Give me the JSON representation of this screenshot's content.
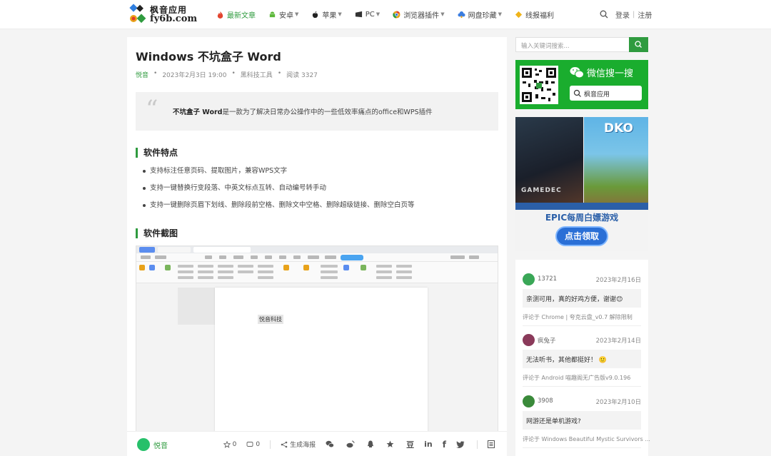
{
  "header": {
    "logo_line1": "枫音应用",
    "logo_line2": "fy6b.com",
    "nav": [
      {
        "label": "最新文章",
        "icon": "fire-icon",
        "active": true,
        "dropdown": false
      },
      {
        "label": "安卓",
        "icon": "android-icon",
        "active": false,
        "dropdown": true
      },
      {
        "label": "苹果",
        "icon": "apple-icon",
        "active": false,
        "dropdown": true
      },
      {
        "label": "PC",
        "icon": "pc-icon",
        "active": false,
        "dropdown": true
      },
      {
        "label": "浏览器插件",
        "icon": "chrome-icon",
        "active": false,
        "dropdown": true
      },
      {
        "label": "网盘珍藏",
        "icon": "cloud-icon",
        "active": false,
        "dropdown": true
      },
      {
        "label": "线报福利",
        "icon": "gift-icon",
        "active": false,
        "dropdown": false
      }
    ],
    "login": "登录",
    "register": "注册"
  },
  "article": {
    "title": "Windows 不坑盒子 Word",
    "author": "悦音",
    "date": "2023年2月3日 19:00",
    "category": "黑科技工具",
    "views": "阅读 3327",
    "quote_bold": "不坑盒子 Word",
    "quote_rest": "是一款为了解决日常办公操作中的一些低效率痛点的office和WPS插件",
    "section1": "软件特点",
    "features": [
      "支持标注任意页码、提取图片，兼容WPS文字",
      "支持一键替换行变段落、中英文标点互转、自动编号转手动",
      "支持一键删除页眉下划线、删除段前空格、删除文中空格、删除超级链接、删除空白页等"
    ],
    "section2": "软件截图",
    "screenshot_text": "悦音科技"
  },
  "toolbar": {
    "author": "悦音",
    "likes": "0",
    "comments": "0",
    "poster": "生成海报"
  },
  "sidebar": {
    "search_placeholder": "输入关键词搜索...",
    "wechat_title": "微信搜一搜",
    "wechat_search": "枫音应用",
    "ad_game1": "GAMEDEC",
    "ad_game2": "DKO",
    "ad_title": "EPIC每周白嫖游戏",
    "ad_button": "点击领取"
  },
  "comments": [
    {
      "user": "13721",
      "date": "2023年2月16日",
      "text": "亲测可用，真的好鸡方便，谢谢😊",
      "ref": "评论于 Chrome | 夸克云盘_v0.7 解除限制",
      "color": "#3aa757"
    },
    {
      "user": "疯兔子",
      "date": "2023年2月14日",
      "text": "无法听书，其他都挺好！ 🙂",
      "ref": "评论于 Android 喵趣阁无广告版v9.0.196",
      "color": "#8a3a5a"
    },
    {
      "user": "3908",
      "date": "2023年2月10日",
      "text": "网游还是单机游戏?",
      "ref": "评论于 Windows Beautiful Mystic Survivors ...",
      "color": "#3a8a3a"
    }
  ]
}
